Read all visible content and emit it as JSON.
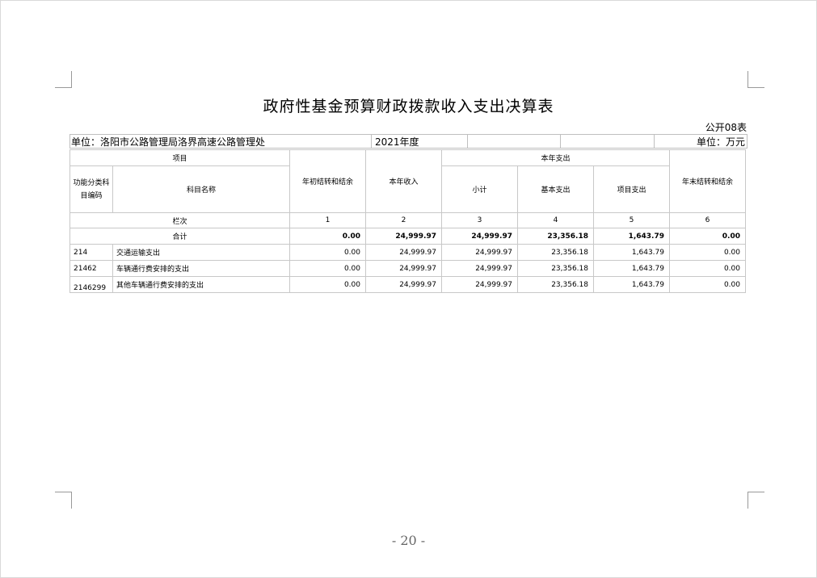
{
  "title": "政府性基金预算财政拨款收入支出决算表",
  "form_code": "公开08表",
  "unit_label": "单位：洛阳市公路管理局洛界高速公路管理处",
  "year": "2021年度",
  "currency": "单位：万元",
  "headers": {
    "item": "项目",
    "code": "功能分类科目编码",
    "subject": "科目名称",
    "opening_balance": "年初结转和结余",
    "income": "本年收入",
    "expenditure": "本年支出",
    "subtotal": "小计",
    "basic": "基本支出",
    "project": "项目支出",
    "closing_balance": "年末结转和结余"
  },
  "column_numbers": {
    "label": "栏次",
    "c1": "1",
    "c2": "2",
    "c3": "3",
    "c4": "4",
    "c5": "5",
    "c6": "6"
  },
  "total_row": {
    "label": "合计",
    "v1": "0.00",
    "v2": "24,999.97",
    "v3": "24,999.97",
    "v4": "23,356.18",
    "v5": "1,643.79",
    "v6": "0.00"
  },
  "rows": [
    {
      "code": "214",
      "name": "交通运输支出",
      "v1": "0.00",
      "v2": "24,999.97",
      "v3": "24,999.97",
      "v4": "23,356.18",
      "v5": "1,643.79",
      "v6": "0.00"
    },
    {
      "code": "21462",
      "name": "车辆通行费安排的支出",
      "v1": "0.00",
      "v2": "24,999.97",
      "v3": "24,999.97",
      "v4": "23,356.18",
      "v5": "1,643.79",
      "v6": "0.00"
    },
    {
      "code": "2146299",
      "name": "其他车辆通行费安排的支出",
      "v1": "0.00",
      "v2": "24,999.97",
      "v3": "24,999.97",
      "v4": "23,356.18",
      "v5": "1,643.79",
      "v6": "0.00"
    }
  ],
  "page_number": "- 20 -"
}
